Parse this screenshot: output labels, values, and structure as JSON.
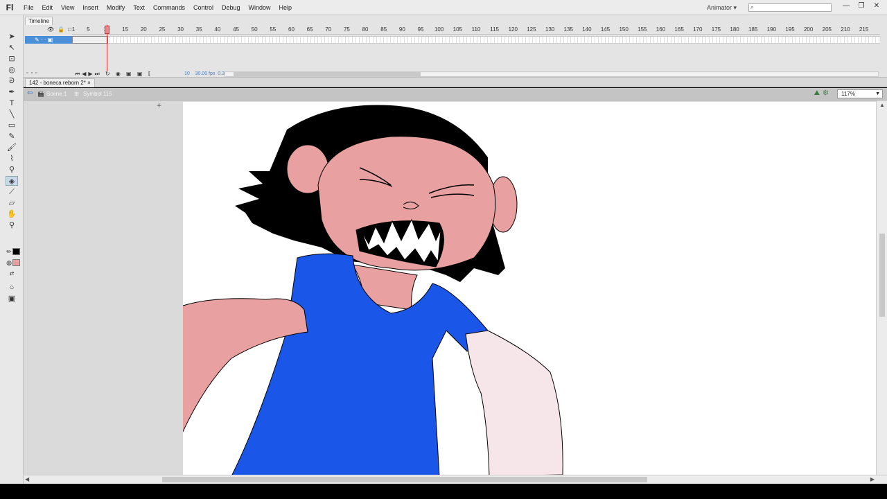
{
  "app": {
    "logo": "Fl",
    "menu": [
      "File",
      "Edit",
      "View",
      "Insert",
      "Modify",
      "Text",
      "Commands",
      "Control",
      "Debug",
      "Window",
      "Help"
    ],
    "workspace": "Animator ▾",
    "window_buttons": [
      "—",
      "❐",
      "✕"
    ]
  },
  "timeline": {
    "tab_label": "Timeline",
    "ruler_ticks": [
      "1",
      "5",
      "10",
      "15",
      "20",
      "25",
      "30",
      "35",
      "40",
      "45",
      "50",
      "55",
      "60",
      "65",
      "70",
      "75",
      "80",
      "85",
      "90",
      "95",
      "100",
      "105",
      "110",
      "115",
      "120",
      "125",
      "130",
      "135",
      "140",
      "145",
      "150",
      "155",
      "160",
      "165",
      "170",
      "175",
      "180",
      "185",
      "190",
      "195",
      "200",
      "205",
      "210",
      "215"
    ],
    "current_frame": "10",
    "fps": "30.00 fps",
    "elapsed": "0.3 s"
  },
  "document": {
    "tab": "142 - boneca reborn 2*",
    "tab_close": "×",
    "crumb_scene": "Scene 1",
    "crumb_symbol": "Symbol 115",
    "zoom": "117%"
  },
  "colors": {
    "stroke": "#000000",
    "fill": "#e8a0a0",
    "shirt": "#1a56e8",
    "skin": "#e8a0a0",
    "hair": "#000000",
    "headband": "#f0c8f0"
  },
  "icons": {
    "toolbox": [
      "selection-icon",
      "subselection-icon",
      "free-transform-icon",
      "3d-rotation-icon",
      "lasso-icon",
      "pen-icon",
      "text-icon",
      "line-icon",
      "rectangle-icon",
      "pencil-icon",
      "brush-icon",
      "paint-brush-icon",
      "bone-icon",
      "paint-bucket-icon",
      "eyedropper-icon",
      "eraser-icon",
      "hand-icon",
      "zoom-icon"
    ]
  }
}
